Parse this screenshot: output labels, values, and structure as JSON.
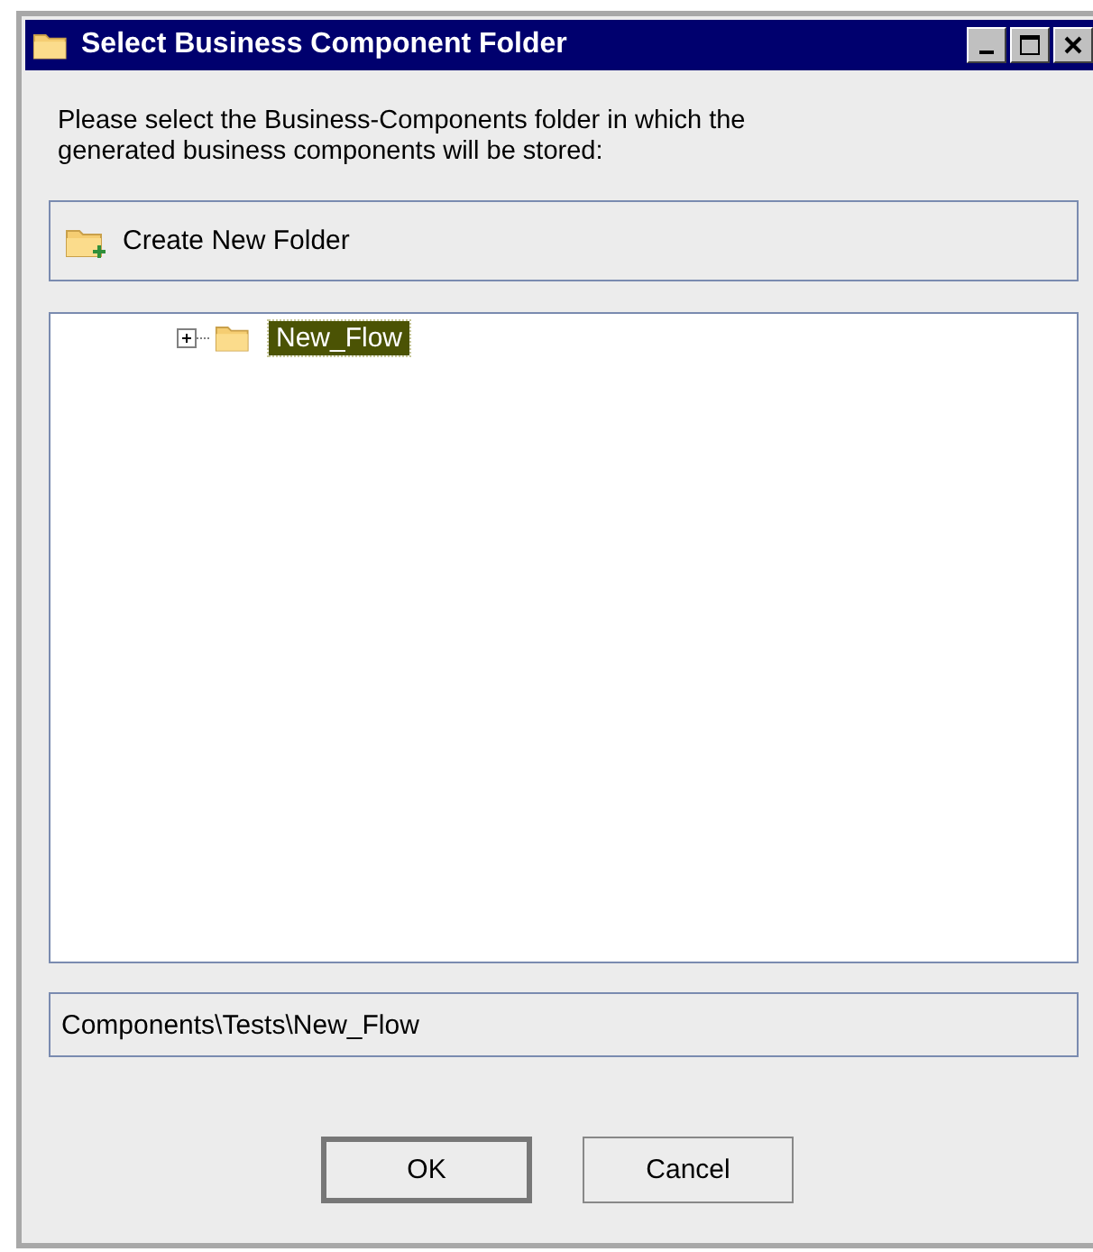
{
  "window": {
    "title": "Select Business Component Folder"
  },
  "instruction": "Please select the Business-Components folder in which the generated business components will be stored:",
  "create_folder_button": {
    "label": "Create New Folder"
  },
  "tree": {
    "items": [
      {
        "label": "New_Flow",
        "expanded": false,
        "selected": true
      }
    ]
  },
  "path_field": {
    "value": "Components\\Tests\\New_Flow"
  },
  "buttons": [
    {
      "label": "OK",
      "kind": "default"
    },
    {
      "label": "Cancel",
      "kind": "normal"
    }
  ]
}
